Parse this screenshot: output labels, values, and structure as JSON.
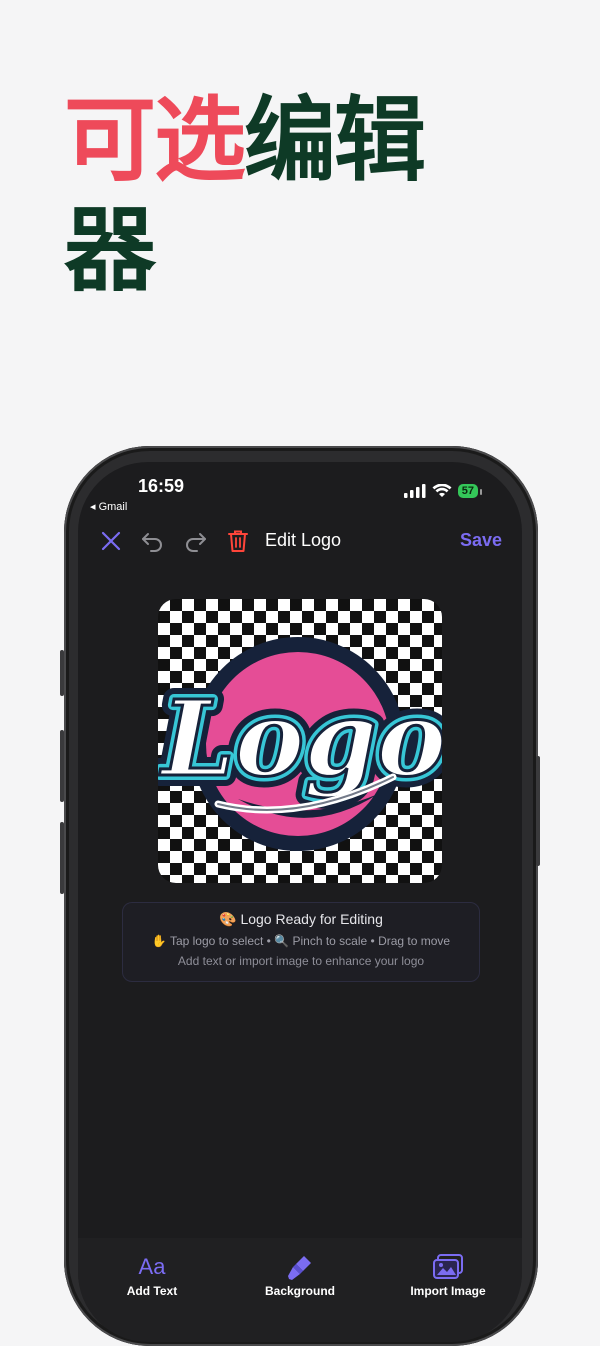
{
  "headline": {
    "part1": "可选",
    "part2": "编辑",
    "part3": "器"
  },
  "status_bar": {
    "time": "16:59",
    "back_app": "◂ Gmail",
    "battery": "57"
  },
  "toolbar": {
    "title": "Edit Logo",
    "save_label": "Save"
  },
  "canvas": {
    "logo_text": "Logo"
  },
  "info_card": {
    "title": "🎨 Logo Ready for Editing",
    "hint1": "✋ Tap logo to select • 🔍 Pinch to scale • Drag to move",
    "hint2": "Add text or import image to enhance your logo"
  },
  "bottom_tools": [
    {
      "label": "Add Text",
      "icon": "text-icon",
      "glyph": "Aa"
    },
    {
      "label": "Background",
      "icon": "brush-icon"
    },
    {
      "label": "Import Image",
      "icon": "image-icon"
    }
  ],
  "colors": {
    "accent": "#7b6cf2",
    "headline_red": "#ee4a5a",
    "headline_green": "#0e3a26",
    "delete_red": "#ff453a",
    "logo_pink": "#e54d96",
    "logo_navy": "#16223a",
    "logo_cyan": "#37c6d6"
  }
}
